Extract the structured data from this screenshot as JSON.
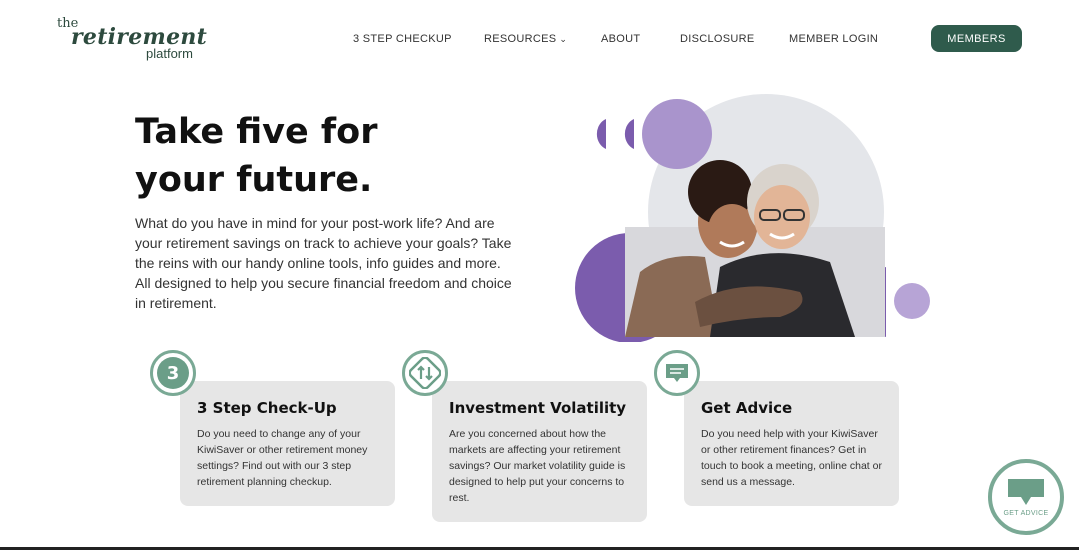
{
  "logo": {
    "line1": "the",
    "line2": "retirement",
    "line3": "platform"
  },
  "nav": {
    "items": [
      "3 STEP CHECKUP",
      "RESOURCES",
      "ABOUT",
      "DISCLOSURE",
      "MEMBER LOGIN"
    ],
    "resources_chevron": "chevron-down-icon",
    "members_label": "MEMBERS"
  },
  "hero": {
    "title_line1": "Take five for",
    "title_line2": "your future.",
    "body": "What do you have in mind for your post-work life? And are your retirement savings on track to achieve your goals? Take the reins with our handy online tools, info guides and more. All designed to help you secure financial freedom and choice in retirement."
  },
  "cards": [
    {
      "badge": "3",
      "icon": "number-three-icon",
      "title": "3 Step Check-Up",
      "body": "Do you need to change any of your KiwiSaver or other retirement money settings? Find out with our 3 step retirement planning checkup."
    },
    {
      "icon": "up-down-arrows-icon",
      "title": "Investment Volatility",
      "body": "Are you concerned about how the markets are affecting your retirement savings?  Our market volatility guide is designed to help put your concerns to rest."
    },
    {
      "icon": "chat-bubble-icon",
      "title": "Get Advice",
      "body": "Do you need help with your KiwiSaver or other retirement finances? Get in touch to book a meeting, online chat or send us a message."
    }
  ],
  "fab": {
    "label": "GET ADVICE",
    "icon": "chat-bubble-icon"
  },
  "colors": {
    "brand_green": "#2f5b4c",
    "badge_green": "#6b9e88",
    "purple": "#7b5cad",
    "light_purple": "#b7a4d6",
    "card_grey": "#e6e6e6"
  }
}
